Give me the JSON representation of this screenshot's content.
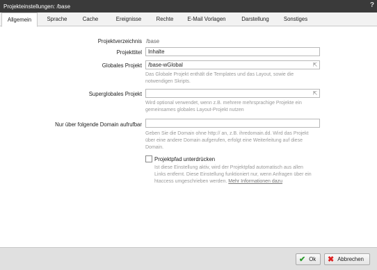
{
  "window": {
    "title": "Projekteinstellungen: /base",
    "help": "?"
  },
  "tabs": [
    {
      "label": "Allgemein"
    },
    {
      "label": "Sprache"
    },
    {
      "label": "Cache"
    },
    {
      "label": "Ereignisse"
    },
    {
      "label": "Rechte"
    },
    {
      "label": "E-Mail Vorlagen"
    },
    {
      "label": "Darstellung"
    },
    {
      "label": "Sonstiges"
    }
  ],
  "form": {
    "projektverzeichnis": {
      "label": "Projektverzeichnis",
      "value": "/base"
    },
    "projekttitel": {
      "label": "Projekttitel",
      "value": "Inhalte"
    },
    "globales_projekt": {
      "label": "Globales Projekt",
      "value": "/base-wGlobal",
      "hint_1": "Das Globale Projekt enthält die Templates und das Layout, sowie die",
      "hint_2": "notwendigen Skripts."
    },
    "superglobales_projekt": {
      "label": "Superglobales Projekt",
      "value": "",
      "hint_1": "Wird optional verwendet, wenn z.B. mehrere mehrsprachige Projekte ein",
      "hint_2": "gemeinsames globales Layout-Projekt nutzen"
    },
    "domain": {
      "label": "Nur über folgende Domain aufrufbar",
      "value": "",
      "hint_1": "Geben Sie die Domain ohne http:// an, z.B. ihredomain.dd. Wird das Projekt",
      "hint_2": "über eine andere Domain aufgerufen, erfolgt eine Weiterleitung auf diese",
      "hint_3": "Domain."
    },
    "projektpfad": {
      "label": "Projektpfad unterdrücken",
      "checked": false,
      "hint_1": "Ist diese Einstellung aktiv, wird der Projektpfad automatisch aus allen",
      "hint_2": "Links entfernt. Diese Einstellung funktioniert nur, wenn Anfragen über ein",
      "hint_3": "htaccess umgeschrieben werden.",
      "link": "Mehr Informationen dazu"
    }
  },
  "footer": {
    "ok_label": "Ok",
    "cancel_label": "Abbrechen"
  }
}
